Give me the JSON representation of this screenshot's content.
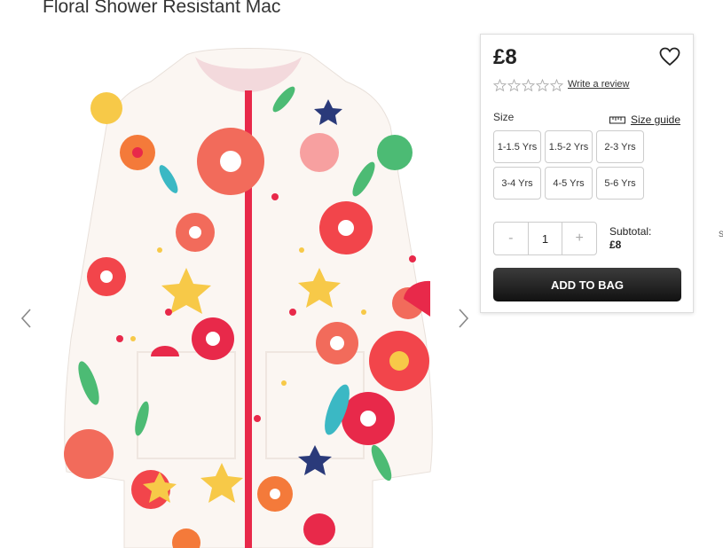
{
  "product": {
    "title": "Floral Shower Resistant Mac",
    "price": "£8",
    "review_link": "Write a review",
    "rating_stars": 0,
    "image_alt": "Floral jacket"
  },
  "sizes": {
    "label": "Size",
    "guide_label": "Size guide",
    "options": [
      "1-1.5 Yrs",
      "1.5-2 Yrs",
      "2-3 Yrs",
      "3-4 Yrs",
      "4-5 Yrs",
      "5-6 Yrs"
    ]
  },
  "quantity": {
    "minus": "-",
    "value": "1",
    "plus": "+"
  },
  "subtotal": {
    "label": "Subtotal:",
    "value": "£8"
  },
  "actions": {
    "add_to_bag": "ADD TO BAG"
  },
  "edge_char": "S",
  "colors": {
    "button": "#222222",
    "coat_red": "#e8294a",
    "coat_base": "#fbf6f2"
  }
}
